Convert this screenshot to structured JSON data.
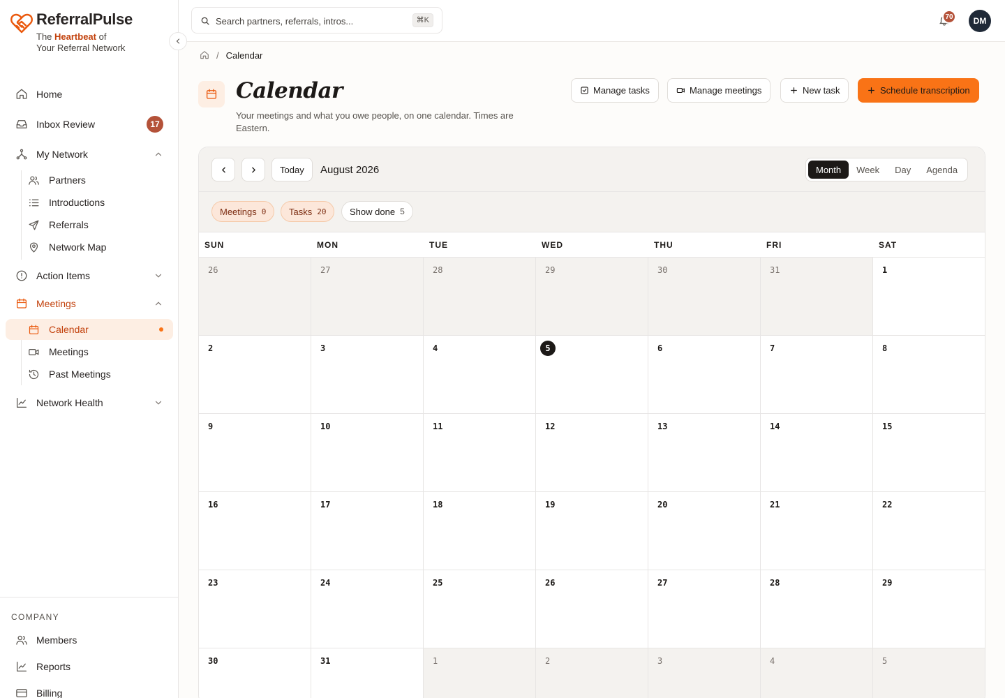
{
  "brand": {
    "name": "ReferralPulse",
    "tagline_pre": "The ",
    "tagline_bold": "Heartbeat",
    "tagline_post": " of",
    "tagline_line2": "Your Referral Network",
    "accent": "#f97316"
  },
  "sidebar": {
    "home": "Home",
    "inbox": {
      "label": "Inbox Review",
      "badge": "17"
    },
    "network": {
      "label": "My Network",
      "items": [
        "Partners",
        "Introductions",
        "Referrals",
        "Network Map"
      ]
    },
    "action_items": "Action Items",
    "meetings": {
      "label": "Meetings",
      "items": [
        "Calendar",
        "Meetings",
        "Past Meetings"
      ]
    },
    "network_health": "Network Health",
    "company_title": "COMPANY",
    "company_items": [
      "Members",
      "Reports",
      "Billing"
    ]
  },
  "topbar": {
    "search_placeholder": "Search partners, referrals, intros...",
    "shortcut": "⌘K",
    "notifications": "70",
    "avatar": "DM"
  },
  "breadcrumb": {
    "current": "Calendar"
  },
  "page": {
    "title": "Calendar",
    "subtitle": "Your meetings and what you owe people, on one calendar. Times are Eastern."
  },
  "actions": {
    "manage_tasks": "Manage tasks",
    "manage_meetings": "Manage meetings",
    "new_task": "New task",
    "schedule": "Schedule transcription"
  },
  "calendar": {
    "today_label": "Today",
    "month_label": "August 2026",
    "views": [
      "Month",
      "Week",
      "Day",
      "Agenda"
    ],
    "active_view": "Month",
    "filters": {
      "meetings": {
        "label": "Meetings",
        "count": "0"
      },
      "tasks": {
        "label": "Tasks",
        "count": "20"
      },
      "show_done": {
        "label": "Show done",
        "count": "5"
      }
    },
    "weekdays": [
      "SUN",
      "MON",
      "TUE",
      "WED",
      "THU",
      "FRI",
      "SAT"
    ],
    "weeks": [
      [
        "26",
        "27",
        "28",
        "29",
        "30",
        "31",
        "1"
      ],
      [
        "2",
        "3",
        "4",
        "5",
        "6",
        "7",
        "8"
      ],
      [
        "9",
        "10",
        "11",
        "12",
        "13",
        "14",
        "15"
      ],
      [
        "16",
        "17",
        "18",
        "19",
        "20",
        "21",
        "22"
      ],
      [
        "23",
        "24",
        "25",
        "26",
        "27",
        "28",
        "29"
      ],
      [
        "30",
        "31",
        "1",
        "2",
        "3",
        "4",
        "5"
      ]
    ],
    "outside_month": [
      [
        0,
        0
      ],
      [
        0,
        1
      ],
      [
        0,
        2
      ],
      [
        0,
        3
      ],
      [
        0,
        4
      ],
      [
        0,
        5
      ],
      [
        5,
        2
      ],
      [
        5,
        3
      ],
      [
        5,
        4
      ],
      [
        5,
        5
      ],
      [
        5,
        6
      ]
    ],
    "today_cell": [
      1,
      3
    ]
  }
}
